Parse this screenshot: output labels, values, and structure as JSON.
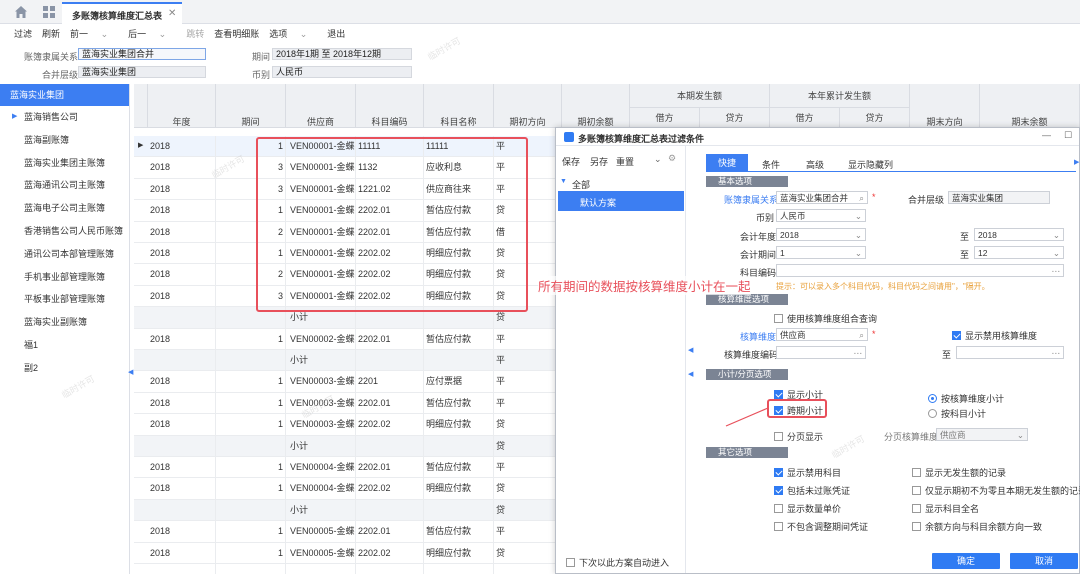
{
  "tab": {
    "title": "多账簿核算维度汇总表"
  },
  "toolbar": {
    "filter": "过滤",
    "refresh": "刷新",
    "prev": "前一",
    "next": "后一",
    "jump": "跳转",
    "view_detail": "查看明细账",
    "options": "选项",
    "exit": "退出"
  },
  "info": {
    "ledger_label": "账簿隶属关系",
    "ledger_value": "蓝海实业集团合并",
    "merge_label": "合并层级",
    "merge_value": "蓝海实业集团",
    "period_label": "期间",
    "period_value": "2018年1期 至 2018年12期",
    "currency_label": "币别",
    "currency_value": "人民币"
  },
  "sidebar": {
    "root": "蓝海实业集团",
    "items": [
      "蓝海销售公司",
      "蓝海副账簿",
      "蓝海实业集团主账簿",
      "蓝海通讯公司主账簿",
      "蓝海电子公司主账簿",
      "香港销售公司人民币账簿",
      "通讯公司本部管理账簿",
      "手机事业部管理账簿",
      "平板事业部管理账簿",
      "蓝海实业副账簿",
      "福1",
      "副2"
    ]
  },
  "grid": {
    "headers": [
      "年度",
      "期间",
      "供应商",
      "科目编码",
      "科目名称",
      "期初方向",
      "期初余额"
    ],
    "period_group": "本期发生额",
    "ytd_group": "本年累计发生额",
    "debit": "借方",
    "credit": "贷方",
    "end_dir": "期末方向",
    "end_bal": "期末余额",
    "rows": [
      [
        "2018",
        "1",
        "VEN00001-金蝶!",
        "11111",
        "11111",
        "平"
      ],
      [
        "2018",
        "3",
        "VEN00001-金蝶!",
        "1132",
        "应收利息",
        "平"
      ],
      [
        "2018",
        "3",
        "VEN00001-金蝶!",
        "1221.02",
        "供应商往来",
        "平"
      ],
      [
        "2018",
        "1",
        "VEN00001-金蝶!",
        "2202.01",
        "暂估应付款",
        "贷"
      ],
      [
        "2018",
        "2",
        "VEN00001-金蝶!",
        "2202.01",
        "暂估应付款",
        "借"
      ],
      [
        "2018",
        "1",
        "VEN00001-金蝶!",
        "2202.02",
        "明细应付款",
        "贷"
      ],
      [
        "2018",
        "2",
        "VEN00001-金蝶!",
        "2202.02",
        "明细应付款",
        "贷"
      ],
      [
        "2018",
        "3",
        "VEN00001-金蝶!",
        "2202.02",
        "明细应付款",
        "贷"
      ],
      [
        "",
        "",
        "小计",
        "",
        "",
        "贷"
      ],
      [
        "2018",
        "1",
        "VEN00002-金蝶!",
        "2202.01",
        "暂估应付款",
        "平"
      ],
      [
        "",
        "",
        "小计",
        "",
        "",
        "平"
      ],
      [
        "2018",
        "1",
        "VEN00003-金蝶!",
        "2201",
        "应付票据",
        "平"
      ],
      [
        "2018",
        "1",
        "VEN00003-金蝶!",
        "2202.01",
        "暂估应付款",
        "平"
      ],
      [
        "2018",
        "1",
        "VEN00003-金蝶!",
        "2202.02",
        "明细应付款",
        "贷"
      ],
      [
        "",
        "",
        "小计",
        "",
        "",
        "贷"
      ],
      [
        "2018",
        "1",
        "VEN00004-金蝶!",
        "2202.01",
        "暂估应付款",
        "平"
      ],
      [
        "2018",
        "1",
        "VEN00004-金蝶!",
        "2202.02",
        "明细应付款",
        "贷"
      ],
      [
        "",
        "",
        "小计",
        "",
        "",
        "贷"
      ],
      [
        "2018",
        "1",
        "VEN00005-金蝶!",
        "2202.01",
        "暂估应付款",
        "平"
      ],
      [
        "2018",
        "1",
        "VEN00005-金蝶!",
        "2202.02",
        "明细应付款",
        "贷"
      ],
      [
        "",
        "",
        "",
        "",
        "",
        ""
      ]
    ]
  },
  "annotation": "所有期间的数据按核算维度小计在一起",
  "dialog": {
    "title": "多账簿核算维度汇总表过滤条件",
    "left": {
      "save": "保存",
      "save_as": "另存",
      "reset": "重置",
      "all": "全部",
      "default_scheme": "默认方案",
      "auto_enter": "下次以此方案自动进入"
    },
    "tabs": [
      "快捷",
      "条件",
      "高级",
      "显示隐藏列"
    ],
    "basic": {
      "title": "基本选项",
      "ledger_label": "账簿隶属关系",
      "ledger_value": "蓝海实业集团合并",
      "merge_label": "合并层级",
      "merge_value": "蓝海实业集团",
      "currency_label": "币别",
      "currency_value": "人民币",
      "year_label": "会计年度",
      "year_from": "2018",
      "year_to": "2018",
      "period_label": "会计期间",
      "period_from": "1",
      "period_to": "12",
      "acct_label": "科目编码",
      "to": "至",
      "hint": "提示：可以录入多个科目代码，科目代码之间请用\"，\"隔开。"
    },
    "dim": {
      "title": "核算维度选项",
      "combo_query": "使用核算维度组合查询",
      "dim_label": "核算维度",
      "dim_value": "供应商",
      "show_disabled_dim": "显示禁用核算维度",
      "dim_code_label": "核算维度编码",
      "to": "至"
    },
    "subtotal": {
      "title": "小计/分页选项",
      "show_subtotal": "显示小计",
      "cross_period": "跨期小计",
      "by_dim": "按核算维度小计",
      "by_account": "按科目小计",
      "page_show": "分页显示",
      "page_dim_label": "分页核算维度",
      "page_dim_value": "供应商"
    },
    "other": {
      "title": "其它选项",
      "opts": [
        "显示禁用科目",
        "显示无发生额的记录",
        "包括未过账凭证",
        "仅显示期初不为零且本期无发生额的记录",
        "显示数量单价",
        "显示科目全名",
        "不包含调整期间凭证",
        "余额方向与科目余额方向一致"
      ]
    },
    "ok": "确定",
    "cancel": "取消"
  },
  "watermark": "临时许可"
}
